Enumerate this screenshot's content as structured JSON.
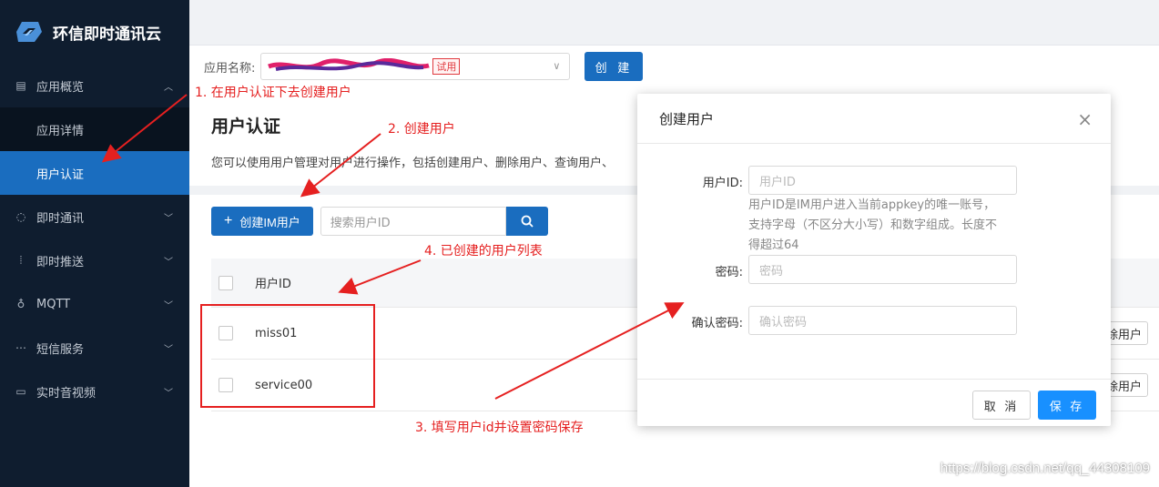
{
  "sidebar": {
    "brand": "环信即时通讯云",
    "items": [
      {
        "label": "应用概览",
        "icon": "list-icon"
      },
      {
        "label": "应用详情"
      },
      {
        "label": "用户认证"
      },
      {
        "label": "即时通讯",
        "icon": "chat-icon"
      },
      {
        "label": "即时推送",
        "icon": "push-icon"
      },
      {
        "label": "MQTT",
        "icon": "mqtt-icon"
      },
      {
        "label": "短信服务",
        "icon": "sms-icon"
      },
      {
        "label": "实时音视频",
        "icon": "video-icon"
      }
    ]
  },
  "appbar": {
    "app_label": "应用名称:",
    "trial_badge": "试用",
    "create_label": "创 建"
  },
  "main": {
    "title": "用户认证",
    "description": "您可以使用用户管理对用户进行操作，包括创建用户、删除用户、查询用户、",
    "add_button": "创建IM用户",
    "search_placeholder": "搜索用户ID",
    "table": {
      "header": "用户ID",
      "rows": [
        {
          "id": "miss01",
          "action": "除用户"
        },
        {
          "id": "service00",
          "action": "除用户"
        }
      ]
    }
  },
  "modal": {
    "title": "创建用户",
    "close": "×",
    "fields": {
      "user_id_label": "用户ID:",
      "user_id_placeholder": "用户ID",
      "help_line1": "用户ID是IM用户进入当前appkey的唯一账号，",
      "help_line2": "支持字母（不区分大小写）和数字组成。长度不",
      "help_line3": "得超过64",
      "password_label": "密码:",
      "password_placeholder": "密码",
      "confirm_label": "确认密码:",
      "confirm_placeholder": "确认密码"
    },
    "cancel": "取 消",
    "save": "保 存"
  },
  "annotations": {
    "a1": "1. 在用户认证下去创建用户",
    "a2": "2. 创建用户",
    "a3": "3. 填写用户id并设置密码保存",
    "a4": "4. 已创建的用户列表"
  },
  "watermark": "https://blog.csdn.net/qq_44308109",
  "colors": {
    "sidebar_bg": "#0f1d2f",
    "accent": "#1a6dbf",
    "annotation": "#e52020"
  }
}
